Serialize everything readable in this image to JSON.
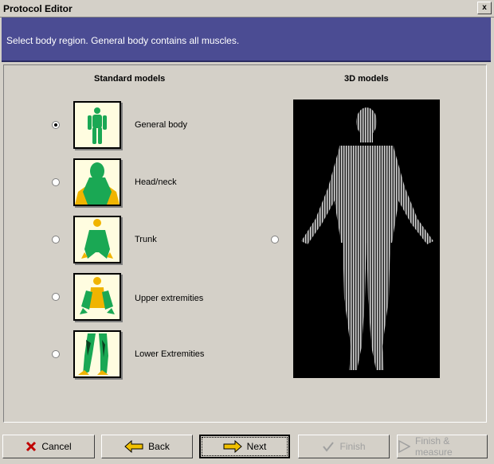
{
  "window": {
    "title": "Protocol Editor",
    "close_symbol": "x"
  },
  "header": {
    "instruction": "Select body region. General body contains all muscles."
  },
  "columns": {
    "standard": "Standard models",
    "three_d": "3D models"
  },
  "models": [
    {
      "label": "General body",
      "icon": "general-body-icon",
      "selected": true
    },
    {
      "label": "Head/neck",
      "icon": "head-neck-icon",
      "selected": false
    },
    {
      "label": "Trunk",
      "icon": "trunk-icon",
      "selected": false
    },
    {
      "label": "Upper extremities",
      "icon": "upper-extremities-icon",
      "selected": false
    },
    {
      "label": "Lower Extremities",
      "icon": "lower-extremities-icon",
      "selected": false
    }
  ],
  "three_d_model": {
    "selected": false,
    "icon": "3d-body-model-image"
  },
  "buttons": {
    "cancel": "Cancel",
    "back": "Back",
    "next": "Next",
    "finish": "Finish",
    "finish_measure": "Finish & measure"
  },
  "colors": {
    "header_bg": "#4b4c93",
    "muscle_green": "#1aa854",
    "highlight_yellow": "#f0b400",
    "thumb_bg": "#fffde0"
  }
}
